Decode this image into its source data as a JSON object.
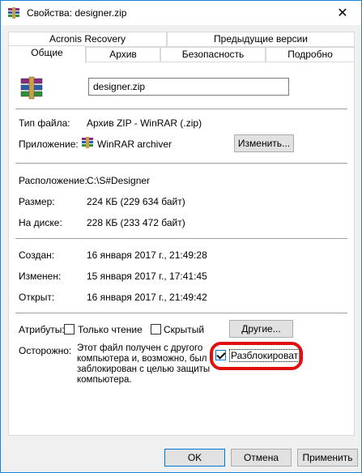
{
  "window": {
    "title": "Свойства: designer.zip",
    "close_glyph": "✕"
  },
  "tabs_row1": [
    "Acronis Recovery",
    "Предыдущие версии"
  ],
  "tabs_row2": [
    "Общие",
    "Архив",
    "Безопасность",
    "Подробно"
  ],
  "general": {
    "filename": "designer.zip",
    "type_label": "Тип файла:",
    "type_value": "Архив ZIP - WinRAR (.zip)",
    "app_label": "Приложение:",
    "app_value": "WinRAR archiver",
    "change_button": "Изменить...",
    "location_label": "Расположение:",
    "location_value": "C:\\S#Designer",
    "size_label": "Размер:",
    "size_value": "224 КБ (229 634 байт)",
    "disk_label": "На диске:",
    "disk_value": "228 КБ (233 472 байт)",
    "created_label": "Создан:",
    "created_value": "16 января 2017 г., 21:49:28",
    "modified_label": "Изменен:",
    "modified_value": "15 января 2017 г., 17:41:45",
    "opened_label": "Открыт:",
    "opened_value": "16 января 2017 г., 21:49:42",
    "attributes_label": "Атрибуты:",
    "readonly_label": "Только чтение",
    "hidden_label": "Скрытый",
    "other_button": "Другие...",
    "caution_label": "Осторожно:",
    "caution_lines": [
      "Этот файл получен с другого",
      "компьютера и, возможно, был",
      "заблокирован с целью защиты",
      "компьютера."
    ],
    "unblock_label": "Разблокироват",
    "unblock_checked": true
  },
  "footer": {
    "ok": "OK",
    "cancel": "Отмена",
    "apply": "Применить"
  },
  "colors": {
    "accent": "#0078d7",
    "highlight_ring": "#e01010"
  }
}
